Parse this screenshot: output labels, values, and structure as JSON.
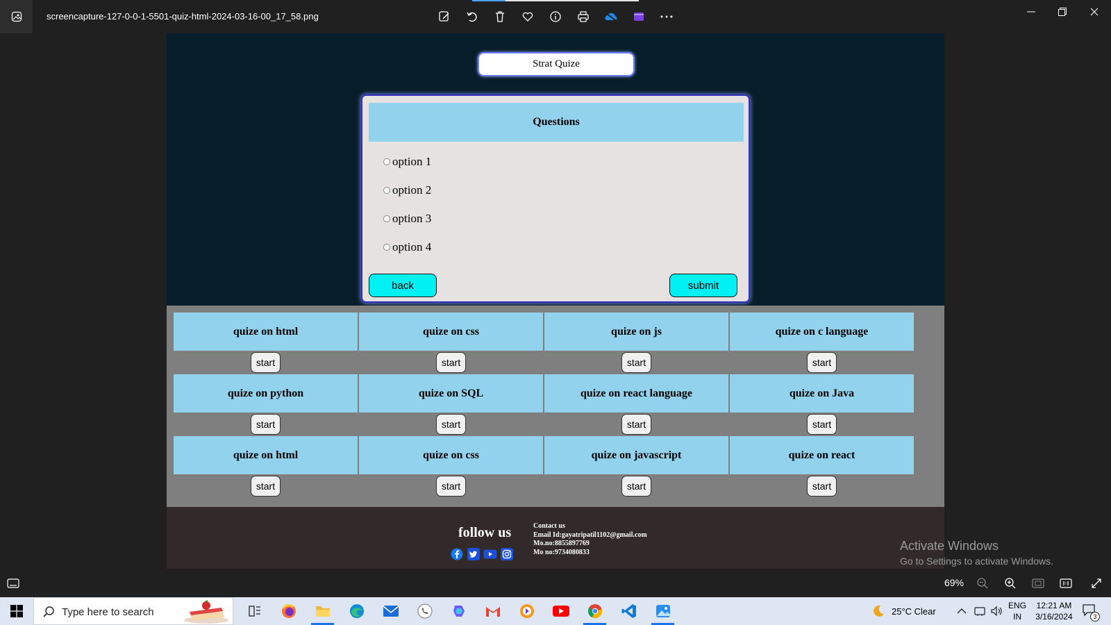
{
  "window": {
    "filename": "screencapture-127-0-0-1-5501-quiz-html-2024-03-16-00_17_58.png",
    "tools": [
      "edit-image-icon",
      "rotate-icon",
      "delete-icon",
      "favorite-icon",
      "info-icon",
      "print-icon",
      "onedrive-icon",
      "clipchamp-icon",
      "more-icon"
    ]
  },
  "quiz_page": {
    "start_button": "Strat Quize",
    "question_title": "Questions",
    "options": [
      "option 1",
      "option 2",
      "option 3",
      "option 4"
    ],
    "back_label": "back",
    "submit_label": "submit",
    "quizzes": [
      {
        "title": "quize on html",
        "button": "start"
      },
      {
        "title": "quize on css",
        "button": "start"
      },
      {
        "title": "quize on js",
        "button": "start"
      },
      {
        "title": "quize on c language",
        "button": "start"
      },
      {
        "title": "quize on python",
        "button": "start"
      },
      {
        "title": "quize on SQL",
        "button": "start"
      },
      {
        "title": "quize on react language",
        "button": "start"
      },
      {
        "title": "quize on Java",
        "button": "start"
      },
      {
        "title": "quize on html",
        "button": "start"
      },
      {
        "title": "quize on css",
        "button": "start"
      },
      {
        "title": "quize on javascript",
        "button": "start"
      },
      {
        "title": "quize on react",
        "button": "start"
      }
    ],
    "footer": {
      "follow_us": "follow us",
      "contact_title": "Contact us",
      "email": "Email Id:gayatripatil1102@gmail.com",
      "mobile1": "Mo.no:8855897769",
      "mobile2": "Mo no:9734080833",
      "social_icons": [
        "facebook-icon",
        "twitter-icon",
        "youtube-icon",
        "instagram-icon"
      ]
    }
  },
  "watermark": {
    "line1": "Activate Windows",
    "line2": "Go to Settings to activate Windows."
  },
  "photo_bar": {
    "zoom": "69%"
  },
  "taskbar": {
    "search_placeholder": "Type here to search",
    "weather": "25°C  Clear",
    "lang1": "ENG",
    "lang2": "IN",
    "time": "12:21 AM",
    "date": "3/16/2024",
    "notification_count": "3"
  },
  "colors": {
    "page_dark": "#071e2a",
    "tile_blue": "#92d2ec",
    "cyan_button": "#00f0f4",
    "grid_gray": "#7f7f7f",
    "footer_brown": "#322a2a"
  }
}
